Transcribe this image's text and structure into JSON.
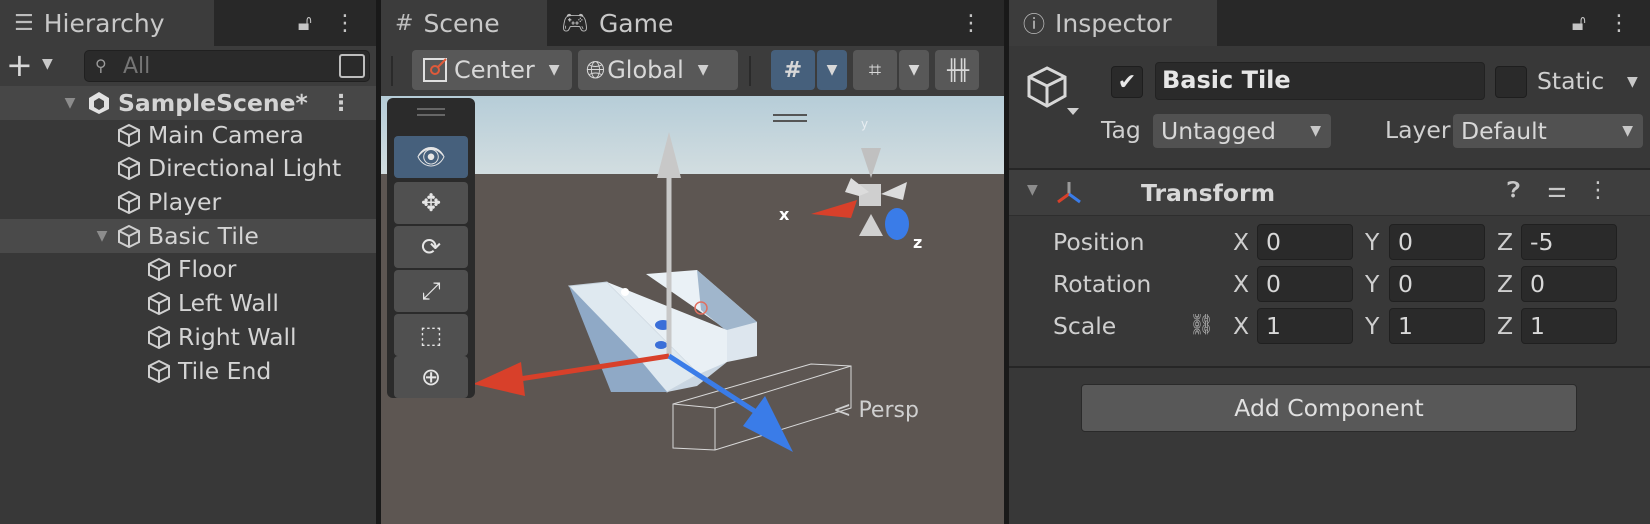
{
  "hierarchy": {
    "tab_label": "Hierarchy",
    "search_placeholder": "All",
    "scene_name": "SampleScene*",
    "items": [
      {
        "label": "Main Camera"
      },
      {
        "label": "Directional Light"
      },
      {
        "label": "Player"
      },
      {
        "label": "Basic Tile"
      },
      {
        "label": "Floor"
      },
      {
        "label": "Left Wall"
      },
      {
        "label": "Right Wall"
      },
      {
        "label": "Tile End"
      }
    ]
  },
  "scene": {
    "tabs": [
      {
        "label": "Scene"
      },
      {
        "label": "Game"
      }
    ],
    "pivot_label": "Center",
    "space_label": "Global",
    "persp_label": "Persp",
    "gizmo_x": "x",
    "gizmo_z": "z",
    "gizmo_y": "y"
  },
  "inspector": {
    "tab_label": "Inspector",
    "object_name": "Basic Tile",
    "active": true,
    "static_label": "Static",
    "tag_label": "Tag",
    "tag_value": "Untagged",
    "layer_label": "Layer",
    "layer_value": "Default",
    "transform_title": "Transform",
    "position_label": "Position",
    "rotation_label": "Rotation",
    "scale_label": "Scale",
    "axis_x": "X",
    "axis_y": "Y",
    "axis_z": "Z",
    "position": {
      "x": "0",
      "y": "0",
      "z": "-5"
    },
    "rotation": {
      "x": "0",
      "y": "0",
      "z": "0"
    },
    "scale": {
      "x": "1",
      "y": "1",
      "z": "1"
    },
    "add_component_label": "Add Component"
  },
  "colors": {
    "x_axis": "#d8402a",
    "z_axis": "#3a7ce8",
    "y_axis": "#b8b8b8",
    "selection": "#46607c"
  }
}
